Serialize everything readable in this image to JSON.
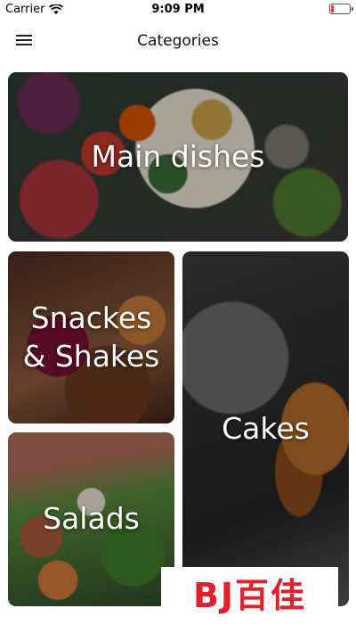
{
  "status_bar": {
    "carrier": "Carrier",
    "time": "9:09 PM",
    "wifi_icon": "wifi-icon",
    "battery_icon": "battery-icon"
  },
  "nav": {
    "title": "Categories",
    "menu_icon": "hamburger-menu-icon"
  },
  "categories": [
    {
      "label": "Main dishes"
    },
    {
      "label": "Snackes & Shakes"
    },
    {
      "label": "Salads"
    },
    {
      "label": "Cakes"
    }
  ],
  "watermark": {
    "text": "BJ百佳"
  }
}
